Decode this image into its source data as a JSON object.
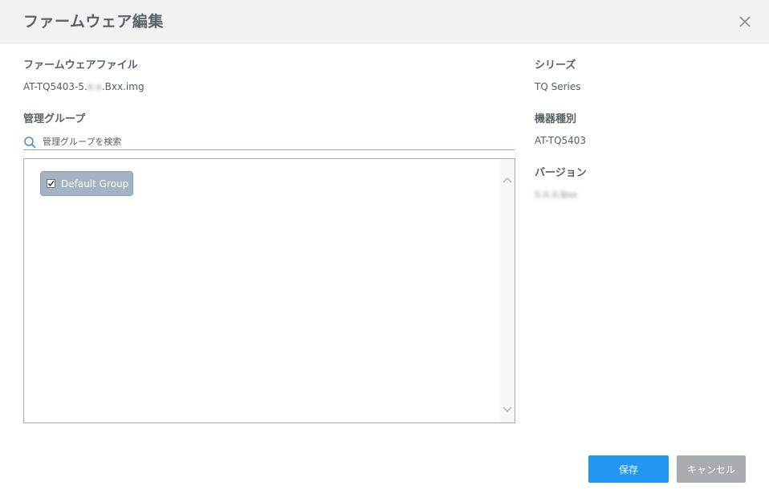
{
  "dialog": {
    "title": "ファームウェア編集",
    "close_icon": "close-icon"
  },
  "firmware_file": {
    "label": "ファームウェアファイル",
    "value_prefix": "AT-TQ5403-5.",
    "value_blurred": "x.x",
    "value_suffix": ".Bxx.img"
  },
  "group": {
    "label": "管理グループ",
    "search_icon": "search-icon",
    "search_placeholder": "管理グループを検索",
    "items": [
      {
        "label": "Default Group",
        "checked": true
      }
    ]
  },
  "series": {
    "label": "シリーズ",
    "value": "TQ Series"
  },
  "model": {
    "label": "機器種別",
    "value": "AT-TQ5403"
  },
  "version": {
    "label": "バージョン",
    "value": "5.X.X.Bxx"
  },
  "footer": {
    "save_label": "保存",
    "cancel_label": "キャンセル"
  },
  "colors": {
    "primary": "#2196f3",
    "cancel": "#a8acb0",
    "chip": "#a3b3c3",
    "header_bg": "#f1f2f4"
  }
}
